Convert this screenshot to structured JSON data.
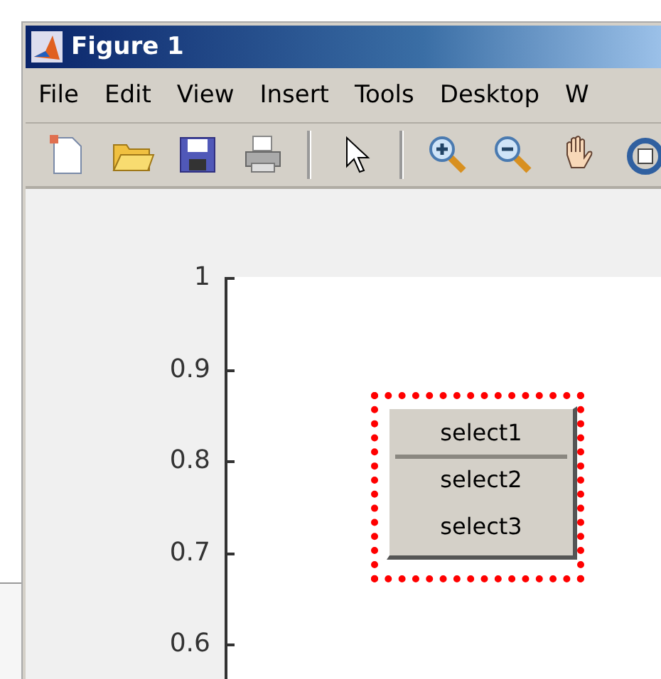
{
  "window": {
    "title": "Figure 1"
  },
  "menu": [
    "File",
    "Edit",
    "View",
    "Insert",
    "Tools",
    "Desktop",
    "W"
  ],
  "toolbar": [
    {
      "kind": "new"
    },
    {
      "kind": "open"
    },
    {
      "kind": "save"
    },
    {
      "kind": "print"
    },
    {
      "kind": "separator"
    },
    {
      "kind": "pointer"
    },
    {
      "kind": "separator"
    },
    {
      "kind": "zoom-in"
    },
    {
      "kind": "zoom-out"
    },
    {
      "kind": "pan"
    },
    {
      "kind": "rotate"
    }
  ],
  "axes": {
    "y_ticks": [
      "1",
      "0.9",
      "0.8",
      "0.7",
      "0.6"
    ]
  },
  "listbox": {
    "items": [
      {
        "label": "select1",
        "selected": true
      },
      {
        "label": "select2",
        "selected": false
      },
      {
        "label": "select3",
        "selected": false
      }
    ]
  }
}
